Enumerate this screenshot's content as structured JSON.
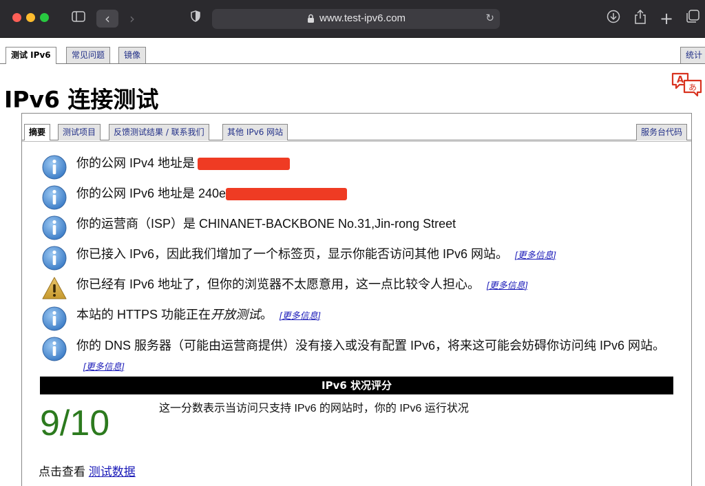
{
  "browser": {
    "url": "www.test-ipv6.com",
    "icons": [
      "sidebar-icon",
      "back-icon",
      "forward-icon",
      "shield-icon",
      "lock-icon",
      "reload-icon",
      "download-icon",
      "share-icon",
      "new-tab-icon",
      "tabs-overview-icon"
    ]
  },
  "nav": {
    "tabs": [
      "测试 IPv6",
      "常见问题",
      "镜像"
    ],
    "right_tab": "统计"
  },
  "page_title": "IPv6 连接测试",
  "subnav": {
    "tabs": [
      "摘要",
      "测试项目",
      "反馈测试结果 / 联系我们",
      "其他 IPv6 网站"
    ],
    "right_tab": "服务台代码"
  },
  "results": [
    {
      "icon": "info-icon",
      "text": "你的公网 IPv4 地址是",
      "redacted": true
    },
    {
      "icon": "info-icon",
      "text": "你的公网 IPv6 地址是 240e",
      "redacted": true
    },
    {
      "icon": "info-icon",
      "text": "你的运营商（ISP）是 CHINANET-BACKBONE No.31,Jin-rong Street"
    },
    {
      "icon": "info-icon",
      "text": "你已接入 IPv6，因此我们增加了一个标签页，显示你能否访问其他 IPv6 网站。",
      "more": "[更多信息]"
    },
    {
      "icon": "warning-icon",
      "text": "你已经有 IPv6 地址了，但你的浏览器不太愿意用，这一点比较令人担心。",
      "more": "[更多信息]"
    },
    {
      "icon": "info-icon",
      "text_before": "本站的 HTTPS 功能正在",
      "text_em": "开放测试",
      "text_after": "。",
      "more": "[更多信息]"
    },
    {
      "icon": "info-icon",
      "text": "你的 DNS 服务器（可能由运营商提供）没有接入或没有配置 IPv6，将来这可能会妨碍你访问纯 IPv6 网站。",
      "more": "[更多信息]"
    }
  ],
  "score": {
    "heading": "IPv6 状况评分",
    "value": "9/10",
    "description": "这一分数表示当访问只支持 IPv6 的网站时，你的 IPv6 运行状况"
  },
  "footer": {
    "prefix": "点击查看",
    "link": "测试数据"
  },
  "colors": {
    "score_green": "#2c7a1e",
    "link_blue": "#1a1ab8",
    "redaction": "#ef3b23"
  }
}
